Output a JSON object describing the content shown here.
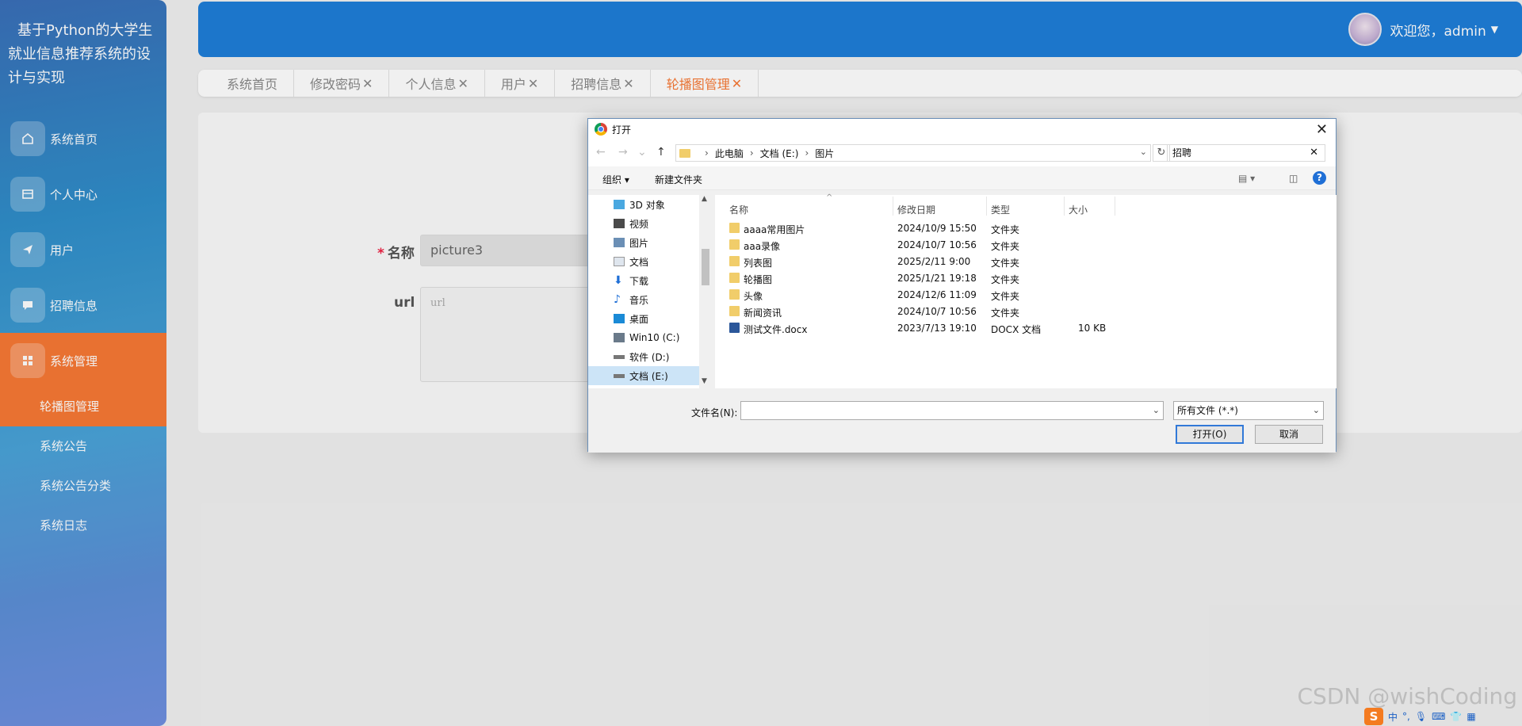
{
  "sidebar": {
    "brand": "基于Python的大学生就业信息推荐系统的设计与实现",
    "items": [
      {
        "label": "系统首页",
        "icon": "home-icon"
      },
      {
        "label": "个人中心",
        "icon": "card-icon"
      },
      {
        "label": "用户",
        "icon": "send-icon"
      },
      {
        "label": "招聘信息",
        "icon": "chat-icon"
      },
      {
        "label": "系统管理",
        "icon": "grid-icon"
      }
    ],
    "sub_items": [
      "轮播图管理",
      "系统公告",
      "系统公告分类",
      "系统日志"
    ]
  },
  "header": {
    "greeting": "欢迎您，admin"
  },
  "tabs": [
    {
      "label": "系统首页",
      "close": ""
    },
    {
      "label": "修改密码",
      "close": "✕"
    },
    {
      "label": "个人信息",
      "close": "✕"
    },
    {
      "label": "用户",
      "close": "✕"
    },
    {
      "label": "招聘信息",
      "close": "✕"
    },
    {
      "label": "轮播图管理",
      "close": "✕"
    }
  ],
  "form": {
    "name_label": "名称",
    "name_value": "picture3",
    "url_label": "url",
    "url_placeholder": "url"
  },
  "dialog": {
    "title": "打开",
    "breadcrumb": [
      "此电脑",
      "文档 (E:)",
      "图片"
    ],
    "search_value": "招聘",
    "toolbar": {
      "organize": "组织 ▾",
      "new_folder": "新建文件夹"
    },
    "tree": [
      "3D 对象",
      "视频",
      "图片",
      "文档",
      "下载",
      "音乐",
      "桌面",
      "Win10 (C:)",
      "软件 (D:)",
      "文档 (E:)"
    ],
    "columns": {
      "name": "名称",
      "date": "修改日期",
      "type": "类型",
      "size": "大小"
    },
    "files": [
      {
        "name": "aaaa常用图片",
        "date": "2024/10/9 15:50",
        "type": "文件夹",
        "size": ""
      },
      {
        "name": "aaa录像",
        "date": "2024/10/7 10:56",
        "type": "文件夹",
        "size": ""
      },
      {
        "name": "列表图",
        "date": "2025/2/11 9:00",
        "type": "文件夹",
        "size": ""
      },
      {
        "name": "轮播图",
        "date": "2025/1/21 19:18",
        "type": "文件夹",
        "size": ""
      },
      {
        "name": "头像",
        "date": "2024/12/6 11:09",
        "type": "文件夹",
        "size": ""
      },
      {
        "name": "新闻资讯",
        "date": "2024/10/7 10:56",
        "type": "文件夹",
        "size": ""
      },
      {
        "name": "测试文件.docx",
        "date": "2023/7/13 19:10",
        "type": "DOCX 文档",
        "size": "10 KB"
      }
    ],
    "filename_label": "文件名(N):",
    "filename_value": "",
    "filetype": "所有文件 (*.*)",
    "open_label": "打开(O)",
    "cancel_label": "取消"
  },
  "watermark": "CSDN @wishCoding",
  "tray": {
    "ime": "中"
  },
  "colors": {
    "accent": "#f77935",
    "header": "#1e7ed8",
    "dialog_border": "#6a8fb8"
  }
}
